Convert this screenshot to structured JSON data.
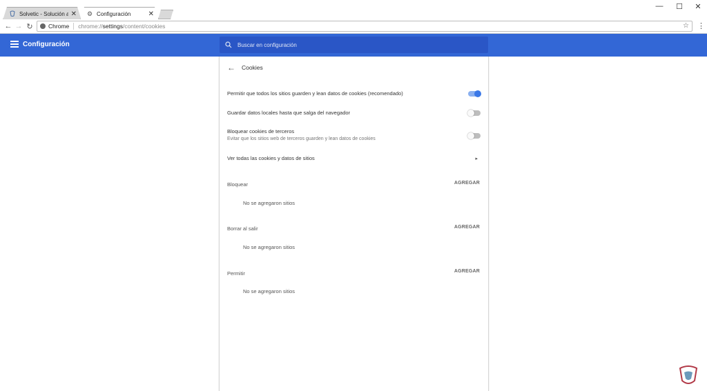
{
  "tabs": [
    {
      "title": "Solvetic - Solución a los p",
      "icon": "solvetic-favicon",
      "active": false
    },
    {
      "title": "Configuración",
      "icon": "gear-icon",
      "active": true
    }
  ],
  "window_controls": {
    "minimize": "—",
    "maximize": "☐",
    "close": "✕"
  },
  "toolbar": {
    "back": "←",
    "forward": "→",
    "reload": "↻",
    "chip_label": "Chrome",
    "url_scheme": "chrome://",
    "url_host": "settings",
    "url_path": "/content/cookies",
    "star": "☆",
    "menu": "⋮"
  },
  "header": {
    "title": "Configuración",
    "search_placeholder": "Buscar en configuración"
  },
  "cookies": {
    "back": "←",
    "title": "Cookies",
    "settings": [
      {
        "label": "Permitir que todos los sitios guarden y lean datos de cookies (recomendado)",
        "sub": "",
        "enabled": true
      },
      {
        "label": "Guardar datos locales hasta que salga del navegador",
        "sub": "",
        "enabled": false
      },
      {
        "label": "Bloquear cookies de terceros",
        "sub": "Evitar que los sitios web de terceros guarden y lean datos de cookies",
        "enabled": false
      }
    ],
    "view_all_label": "Ver todas las cookies y datos de sitios",
    "view_all_arrow": "▸",
    "sections": [
      {
        "title": "Bloquear",
        "action": "AGREGAR",
        "empty": "No se agregaron sitios"
      },
      {
        "title": "Borrar al salir",
        "action": "AGREGAR",
        "empty": "No se agregaron sitios"
      },
      {
        "title": "Permitir",
        "action": "AGREGAR",
        "empty": "No se agregaron sitios"
      }
    ]
  },
  "colors": {
    "header": "#3367d6",
    "search": "#2a56c6",
    "toggle_on": "#3a78e7"
  }
}
